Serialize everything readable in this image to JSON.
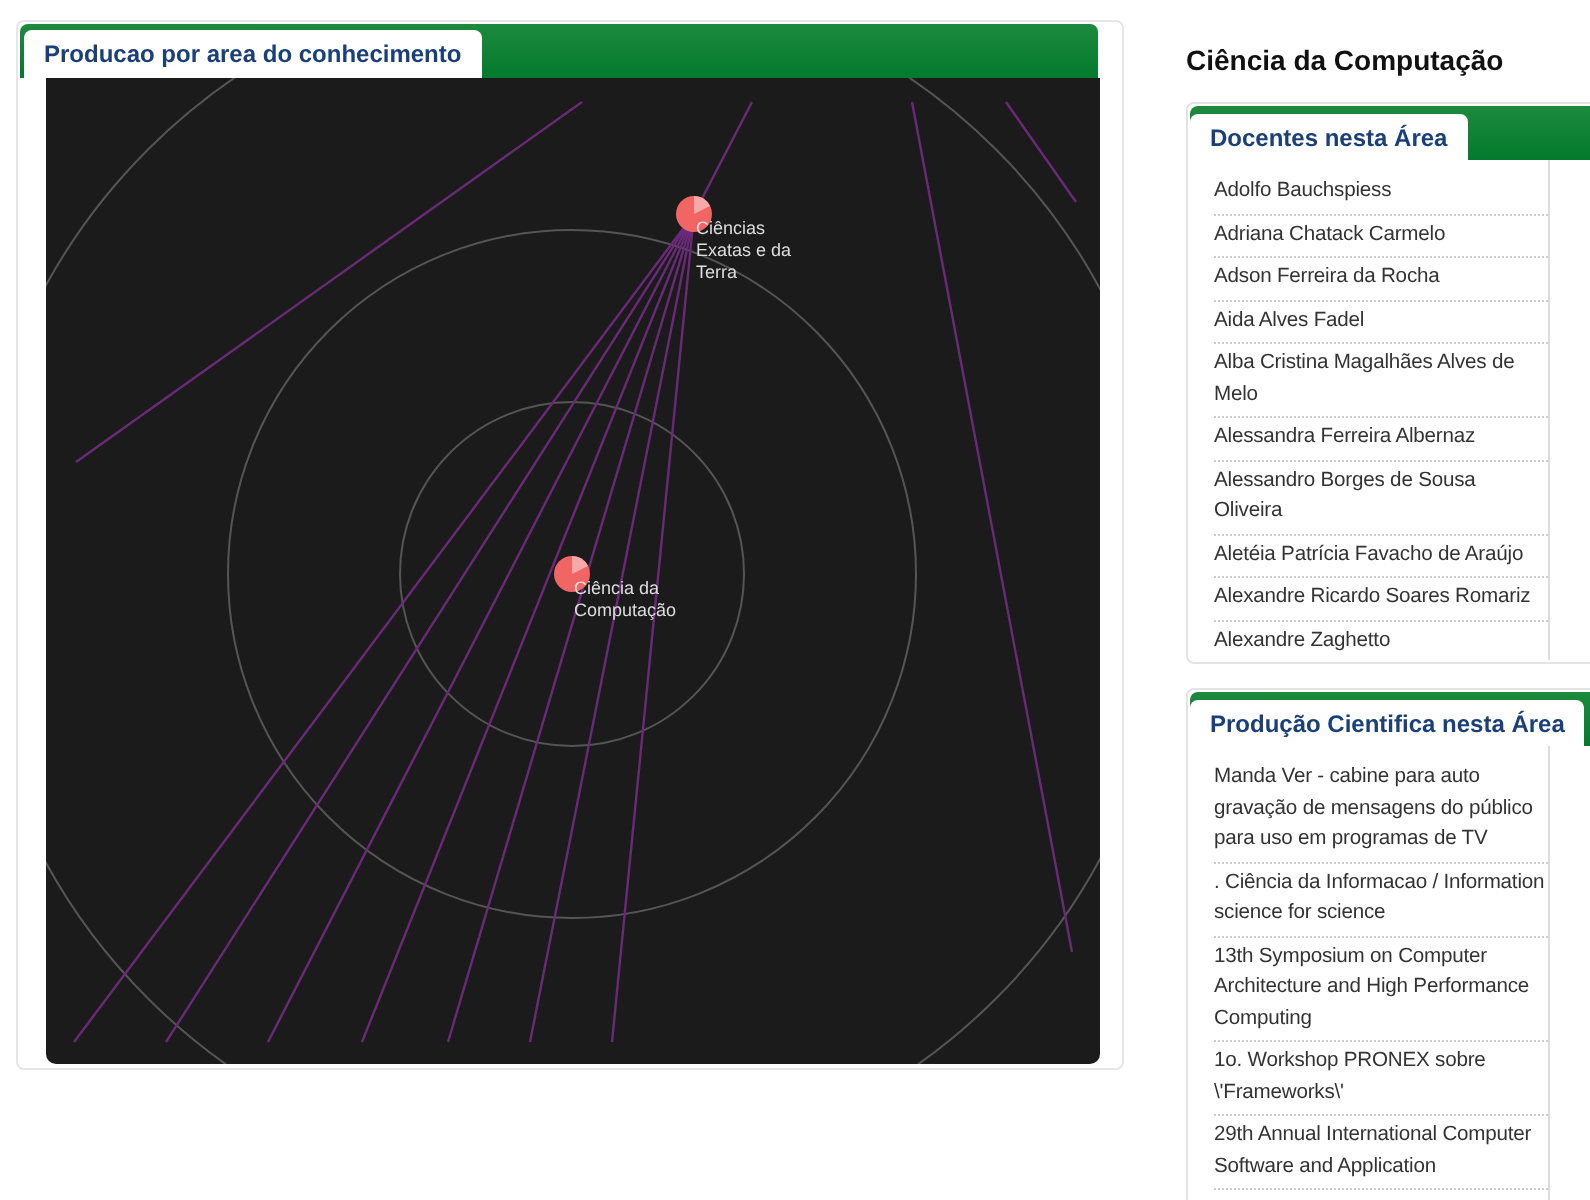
{
  "graph_panel": {
    "tab": {
      "label": "Producao por area do conhecimento",
      "selected": true
    },
    "nodes": [
      {
        "label": "Ciências Exatas e da Terra"
      },
      {
        "label": "Ciência da Computação"
      }
    ]
  },
  "title": "Ciência da Computação",
  "docentes": {
    "tab": {
      "label": "Docentes nesta Área",
      "selected": true
    },
    "items": [
      "Adolfo Bauchspiess",
      "Adriana Chatack Carmelo",
      "Adson Ferreira da Rocha",
      "Aida Alves Fadel",
      "Alba Cristina Magalhães Alves de Melo",
      "Alessandra Ferreira Albernaz",
      "Alessandro Borges de Sousa Oliveira",
      "Aletéia Patrícia Favacho de Araújo",
      "Alexandre Ricardo Soares Romariz",
      "Alexandre Zaghetto"
    ]
  },
  "producao": {
    "tab": {
      "label": "Produção Cientifica nesta Área",
      "selected": true
    },
    "items": [
      "Manda Ver - cabine para auto gravação de mensagens do público para uso em programas de TV",
      ". Ciência da Informacao / Information science for science",
      "13th Symposium on Computer Architecture and High Performance Computing",
      "1o. Workshop PRONEX sobre \\'Frameworks\\'",
      "29th Annual International Computer Software and Application"
    ]
  }
}
